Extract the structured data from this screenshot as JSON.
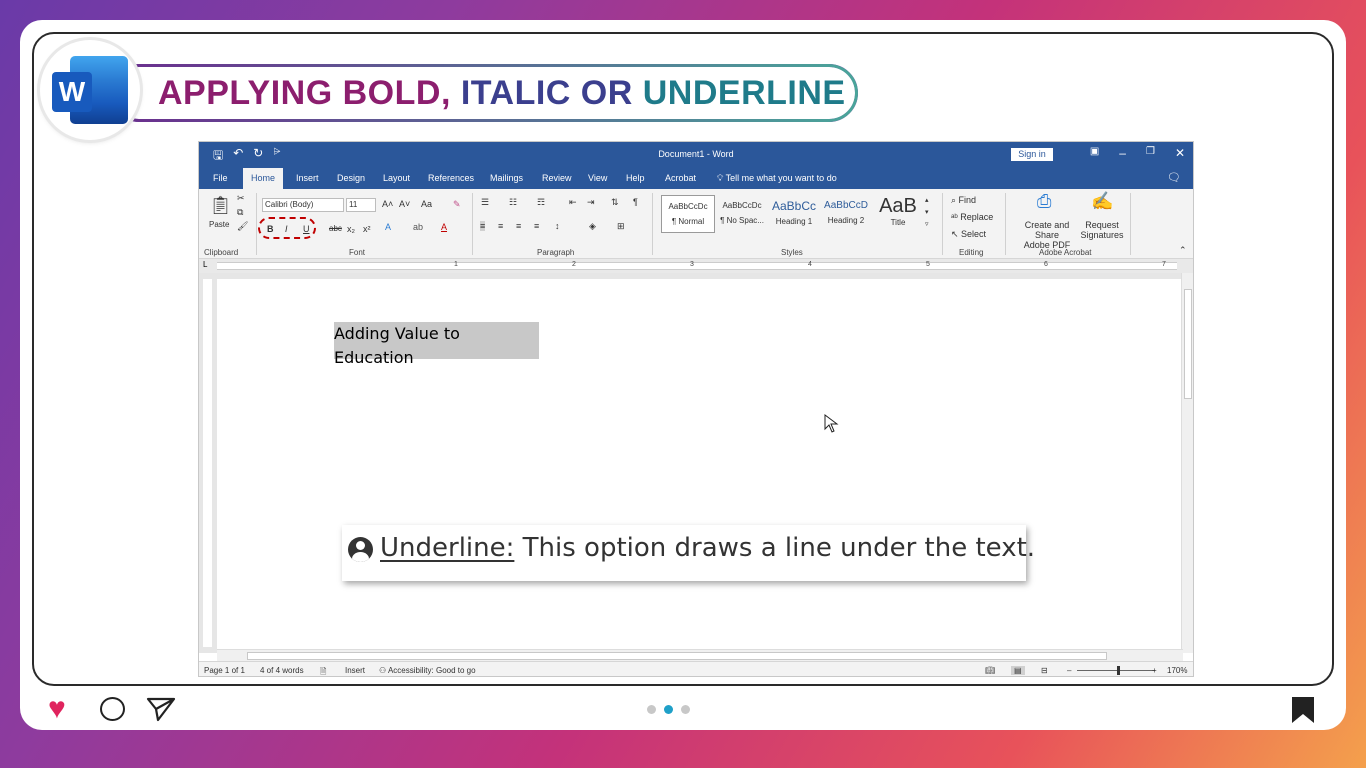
{
  "header": {
    "title_part1": "APPLYING BOLD, ",
    "title_part2": "ITALIC OR ",
    "title_part3": "UNDERLINE",
    "logo_letter": "W"
  },
  "word": {
    "doc_title": "Document1  -  Word",
    "signin": "Sign in",
    "tabs": [
      "File",
      "Home",
      "Insert",
      "Design",
      "Layout",
      "References",
      "Mailings",
      "Review",
      "View",
      "Help",
      "Acrobat"
    ],
    "tell_me": "Tell me what you want to do",
    "clipboard": {
      "paste": "Paste",
      "label": "Clipboard"
    },
    "font": {
      "name": "Calibri (Body)",
      "size": "11",
      "label": "Font",
      "bold": "B",
      "italic": "I",
      "underline": "U",
      "case": "Aa"
    },
    "paragraph": {
      "label": "Paragraph"
    },
    "styles": {
      "label": "Styles",
      "items": [
        {
          "sample": "AaBbCcDc",
          "name": "¶ Normal"
        },
        {
          "sample": "AaBbCcDc",
          "name": "¶ No Spac..."
        },
        {
          "sample": "AaBbCc",
          "name": "Heading 1"
        },
        {
          "sample": "AaBbCcD",
          "name": "Heading 2"
        },
        {
          "sample": "AaB",
          "name": "Title"
        }
      ]
    },
    "editing": {
      "find": "Find",
      "replace": "Replace",
      "select": "Select",
      "label": "Editing"
    },
    "acrobat": {
      "create": "Create and Share",
      "create2": "Adobe PDF",
      "request": "Request",
      "request2": "Signatures",
      "label": "Adobe Acrobat"
    },
    "ruler_numbers": [
      "1",
      "2",
      "3",
      "4",
      "5",
      "6",
      "7"
    ],
    "document_text": "Adding Value to Education",
    "status": {
      "page": "Page 1 of 1",
      "words": "4 of 4 words",
      "mode": "Insert",
      "accessibility": "Accessibility: Good to go",
      "zoom": "170%"
    }
  },
  "callout": {
    "term": "Underline:",
    "text": " This option draws a line under the text."
  },
  "colors": {
    "word_blue": "#2b579a",
    "accent_red": "#c00000",
    "heart": "#e0245e",
    "dot_active": "#1fa0c8"
  }
}
